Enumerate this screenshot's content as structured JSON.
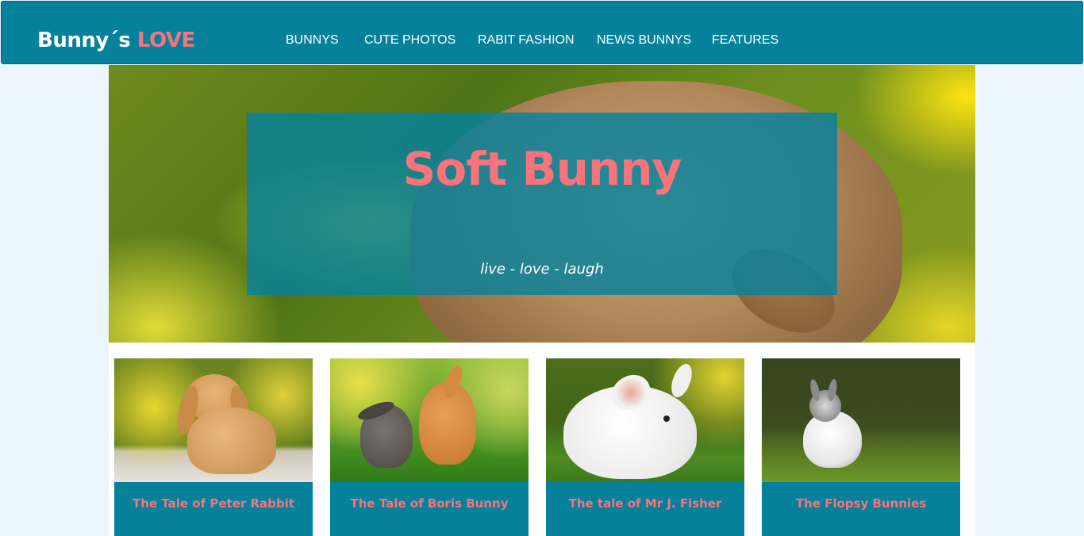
{
  "brand": {
    "part1": "Bunny´s",
    "part2": "LOVE"
  },
  "nav": {
    "items": [
      {
        "label": "BUNNYS"
      },
      {
        "label": "CUTE PHOTOS"
      },
      {
        "label": "RABIT FASHION"
      },
      {
        "label": "NEWS BUNNYS"
      },
      {
        "label": "FEATURES"
      }
    ]
  },
  "hero": {
    "title": "Soft Bunny",
    "subtitle": "live - love - laugh"
  },
  "cards": [
    {
      "title": "The Tale of Peter Rabbit"
    },
    {
      "title": "The Tale of Boris Bunny"
    },
    {
      "title": "The tale of Mr J. Fisher"
    },
    {
      "title": "The Flopsy Bunnies"
    }
  ],
  "colors": {
    "primary": "#06819c",
    "accent": "#f6747a",
    "page_background": "#eaf5fc"
  }
}
